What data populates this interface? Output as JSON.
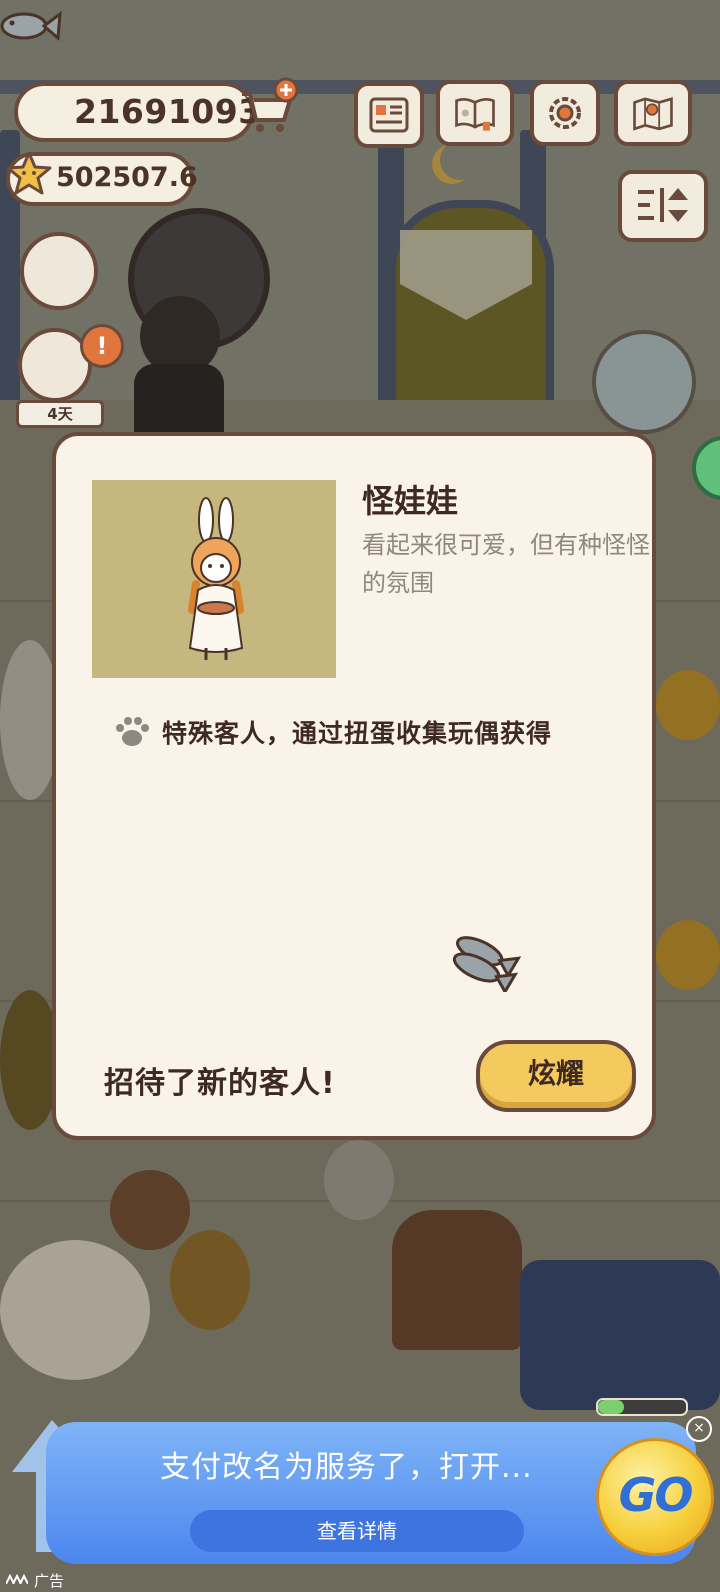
{
  "hud": {
    "fish_amount": "21691093",
    "star_amount": "502507.6",
    "buttons": [
      "menu-card-icon",
      "cat-book-icon",
      "settings-gear-icon",
      "map-icon"
    ]
  },
  "scene": {
    "days_badge": "4天",
    "alert_symbol": "!"
  },
  "dialog": {
    "name": "怪娃娃",
    "description": "看起来很可爱，但有种怪怪的氛围",
    "source": "特殊客人，通过扭蛋收集玩偶获得",
    "new_guest_text": "招待了新的客人!",
    "show_button": "炫耀"
  },
  "ad": {
    "title": "支付改名为服务了，打开...",
    "detail_button": "查看详情",
    "go_label": "GO",
    "tag": "广告",
    "close_symbol": "×"
  },
  "colors": {
    "border_brown": "#6a4a3a",
    "dialog_bg": "#faf3e9",
    "button_yellow": "#f4c95e",
    "ad_blue": "#4c86ee"
  }
}
